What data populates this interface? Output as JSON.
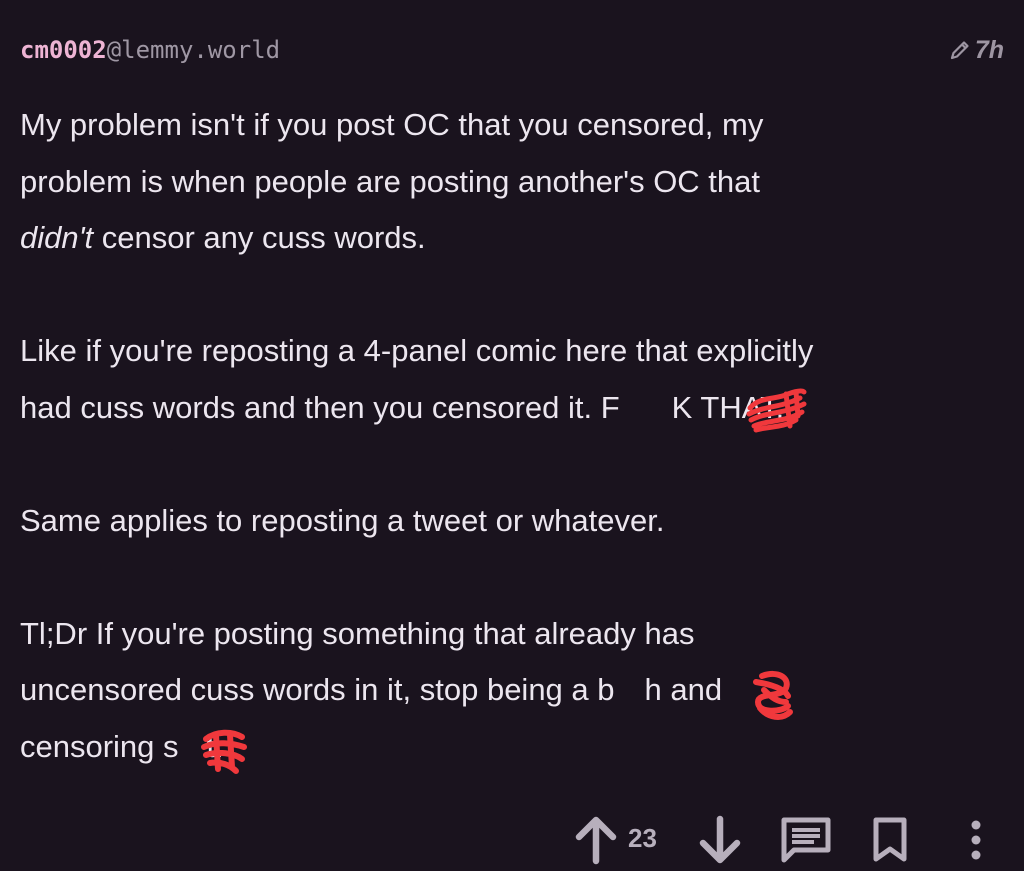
{
  "comment": {
    "author_name": "cm0002",
    "author_instance": "@lemmy.world",
    "edited_time": "7h",
    "icons": {
      "edited": "pencil-icon",
      "upvote": "arrow-up-icon",
      "downvote": "arrow-down-icon",
      "reply": "comment-icon",
      "save": "bookmark-icon",
      "more": "more-vertical-icon"
    },
    "body": {
      "p1_line1": "My problem isn't if you post OC that you censored, my",
      "p1_line2": "problem is when people are posting another's OC that",
      "p1_line3_em": "didn't",
      "p1_line3_rest": " censor any cuss words.",
      "p2_line1": "Like if you're reposting a 4-panel comic here that explicitly",
      "p2_line2_a": "had cuss words and then you censored it. F",
      "p2_line2_b": "K THAT.",
      "p3_line1": "Same applies to reposting a tweet or whatever.",
      "p4_line1": "Tl;Dr If you're posting something that already has",
      "p4_line2_a": "uncensored cuss words in it, stop being a b",
      "p4_line2_b": "h and",
      "p4_line3_a": "censoring s",
      "p4_line3_b": "t."
    },
    "score": "23"
  },
  "colors": {
    "background": "#1a131e",
    "text": "#ece6ef",
    "username": "#eeb4d4",
    "instance": "#9f97a4",
    "muted": "#9d95a2",
    "redaction": "#f0383c"
  }
}
